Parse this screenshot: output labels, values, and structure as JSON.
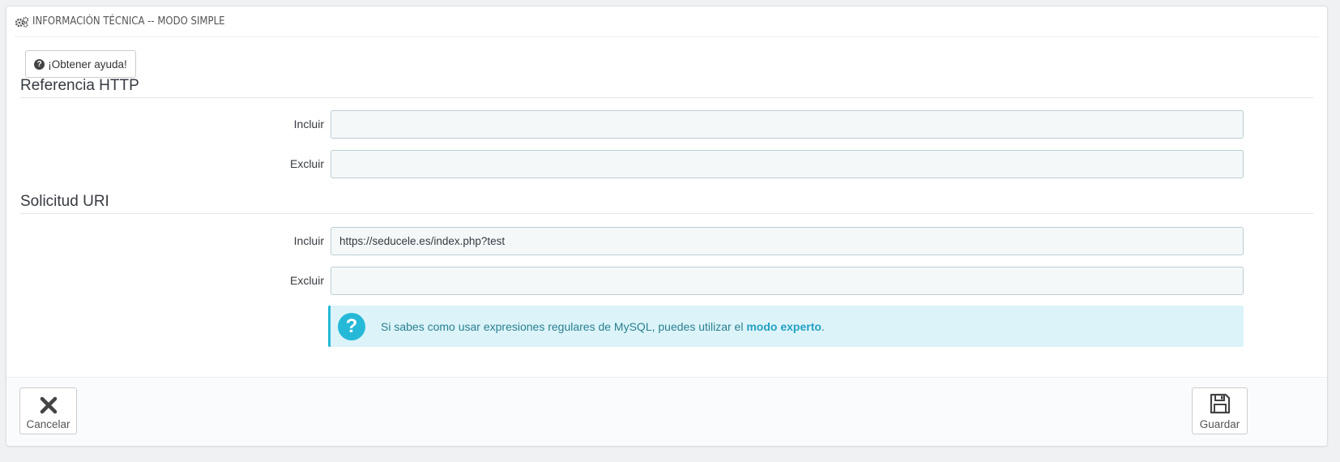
{
  "panel": {
    "title": "INFORMACIÓN TÉCNICA -- MODO SIMPLE",
    "title_icon": "gears-icon"
  },
  "help_button": {
    "label": "¡Obtener ayuda!",
    "icon": "question-circle-icon"
  },
  "sections": [
    {
      "title": "Referencia HTTP",
      "fields": [
        {
          "label": "Incluir",
          "value": ""
        },
        {
          "label": "Excluir",
          "value": ""
        }
      ]
    },
    {
      "title": "Solicitud URI",
      "fields": [
        {
          "label": "Incluir",
          "value": "https://seducele.es/index.php?test"
        },
        {
          "label": "Excluir",
          "value": ""
        }
      ]
    }
  ],
  "alert": {
    "text": "Si sabes como usar expresiones regulares de MySQL, puedes utilizar el",
    "link": "modo experto",
    "suffix": ".",
    "icon": "question-circle-icon"
  },
  "footer": {
    "cancel_label": "Cancelar",
    "cancel_icon": "close-icon",
    "save_label": "Guardar",
    "save_icon": "floppy-disk-icon"
  },
  "colors": {
    "accent": "#25b9d7",
    "alert_bg": "#dcf4f9",
    "input_bg": "#f5f8f9",
    "page_bg": "#eff1f2"
  }
}
